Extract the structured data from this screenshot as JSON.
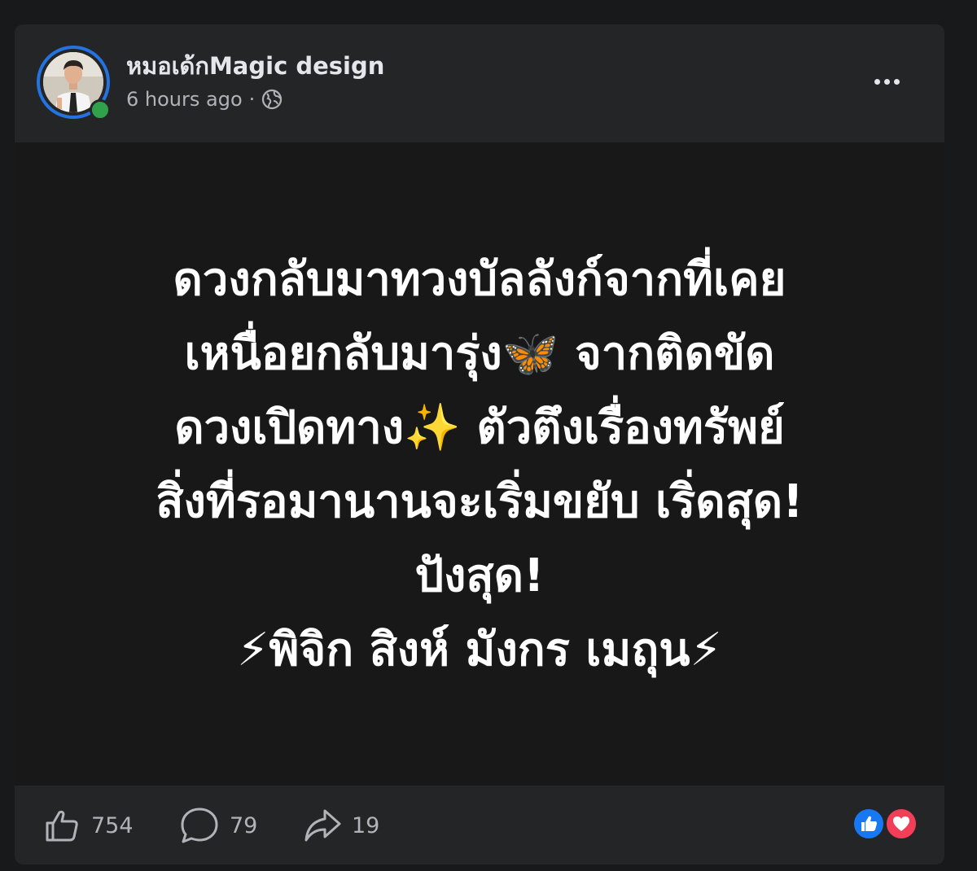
{
  "post": {
    "author": "หมอเด้กMagic design",
    "timestamp": "6 hours ago",
    "separator": "·",
    "privacy_icon": "globe-icon",
    "more_icon": "more-options-icon",
    "body_lines": [
      "ดวงกลับมาทวงบัลลังก์จากที่เคย",
      "เหนื่อยกลับมารุ่ง🦋 จากติดขัด",
      "ดวงเปิดทาง✨ ตัวตึงเรื่องทรัพย์",
      "สิ่งที่รอมานานจะเริ่มขยับ เริ่ดสุด!",
      "ปังสุด!",
      "⚡พิจิก สิงห์ มังกร เมถุน⚡"
    ]
  },
  "footer": {
    "likes": "754",
    "comments": "79",
    "shares": "19",
    "like_icon": "thumbs-up-icon",
    "comment_icon": "comment-bubble-icon",
    "share_icon": "share-arrow-icon",
    "reaction_icons": [
      "like-reaction-icon",
      "love-reaction-icon"
    ]
  },
  "colors": {
    "background": "#18191a",
    "card": "#181818",
    "header": "#242526",
    "text_primary": "#e4e6eb",
    "text_secondary": "#b0b3b8",
    "avatar_ring": "#2374e1",
    "online": "#31a24c",
    "like_blue": "#1877f2",
    "love_red": "#f33e58"
  }
}
